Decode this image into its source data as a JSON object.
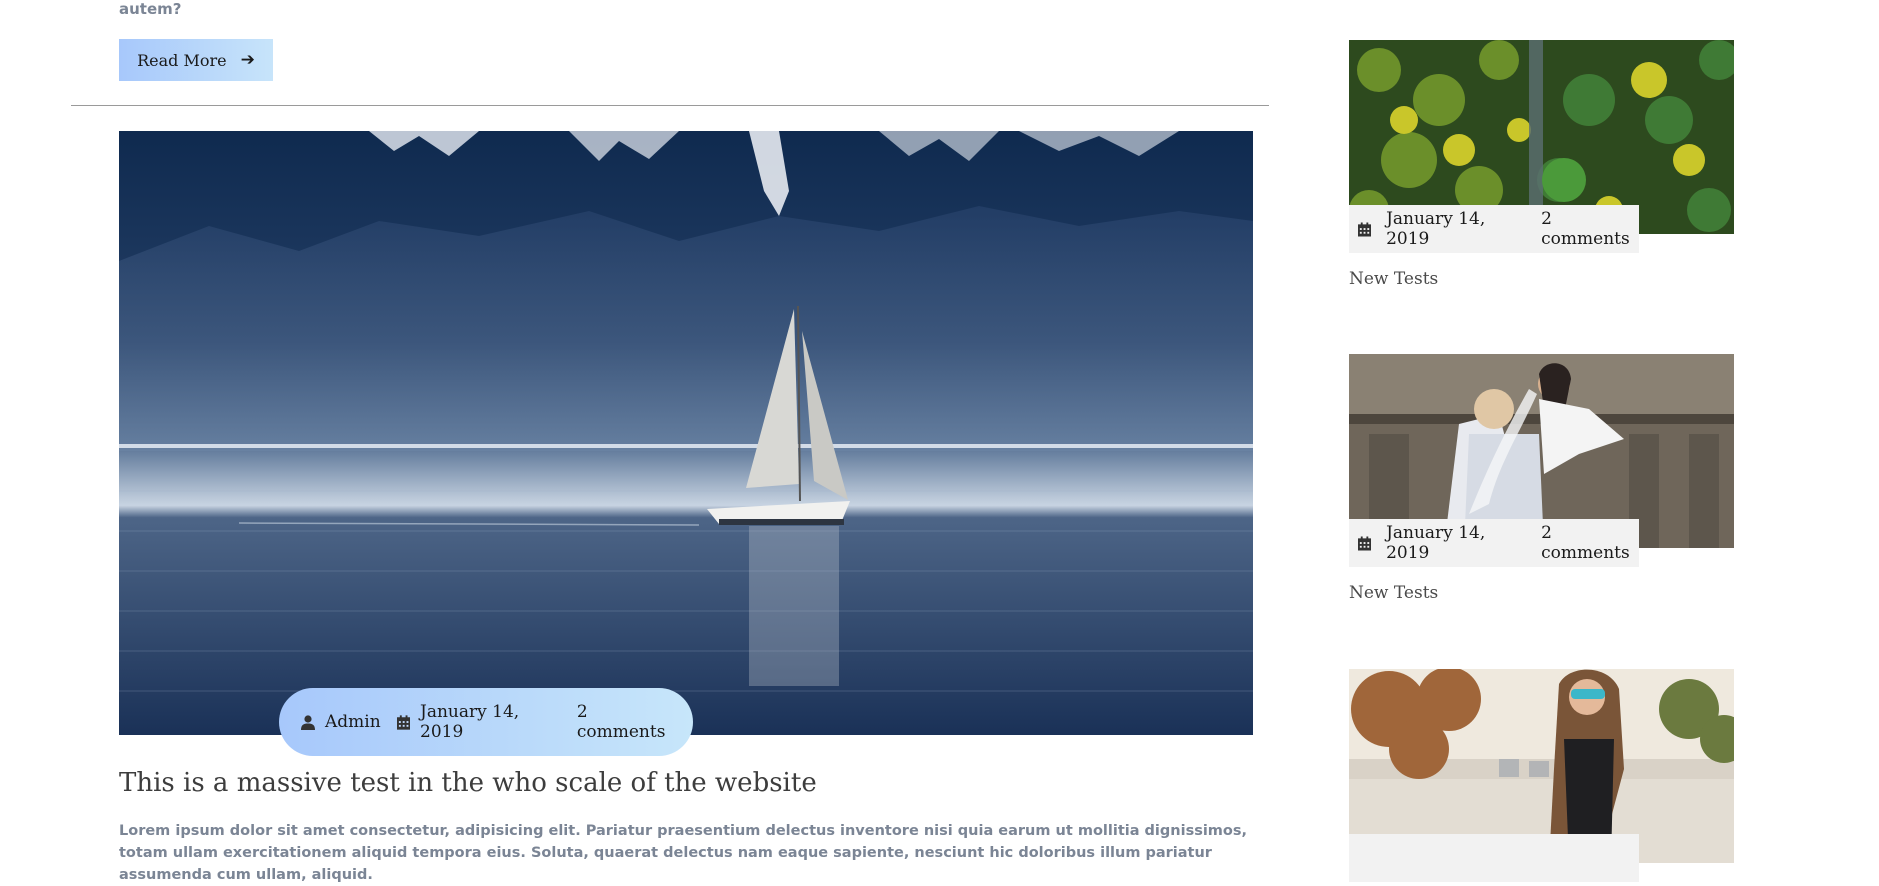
{
  "post_top": {
    "trailing_text": "autem?",
    "read_more_label": "Read More"
  },
  "post": {
    "author": "Admin",
    "date": "January 14, 2019",
    "comments": "2 comments",
    "title": "This is a massive test in the who scale of the website",
    "excerpt": "Lorem ipsum dolor sit amet consectetur, adipisicing elit. Pariatur praesentium delectus inventore nisi quia earum ut mollitia dignissimos, totam ullam exercitationem aliquid tempora eius. Soluta, quaerat delectus nam eaque sapiente, nesciunt hic doloribus illum pariatur assumenda cum ullam, aliquid."
  },
  "sidebar": {
    "posts": [
      {
        "date": "January 14, 2019",
        "comments": "2 comments",
        "title": "New Tests"
      },
      {
        "date": "January 14, 2019",
        "comments": "2 comments",
        "title": "New Tests"
      },
      {
        "date": "",
        "comments": "",
        "title": ""
      }
    ]
  },
  "colors": {
    "accent_gradient_start": "#a7c8fb",
    "accent_gradient_end": "#c7e4fa",
    "meta_background": "#f2f2f2",
    "excerpt_text": "#7b8595"
  },
  "icons": {
    "read_more": "arrow-right-icon",
    "author": "user-icon",
    "date": "calendar-icon"
  }
}
